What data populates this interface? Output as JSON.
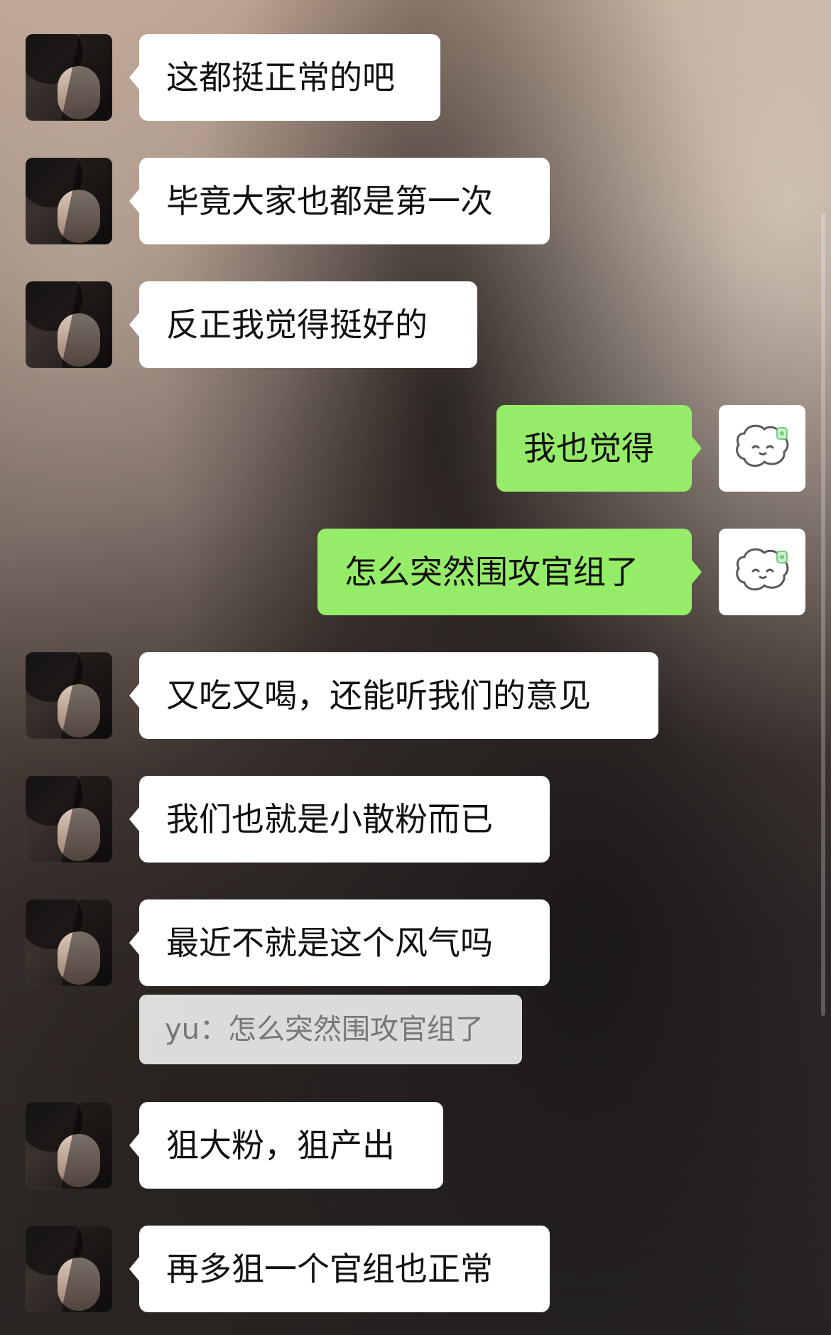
{
  "chat": {
    "messages": [
      {
        "side": "left",
        "text": "这都挺正常的吧"
      },
      {
        "side": "left",
        "text": "毕竟大家也都是第一次"
      },
      {
        "side": "left",
        "text": "反正我觉得挺好的"
      },
      {
        "side": "right",
        "text": "我也觉得"
      },
      {
        "side": "right",
        "text": "怎么突然围攻官组了"
      },
      {
        "side": "left",
        "text": "又吃又喝，还能听我们的意见"
      },
      {
        "side": "left",
        "text": "我们也就是小散粉而已"
      },
      {
        "side": "left",
        "text": "最近不就是这个风气吗"
      },
      {
        "side": "left",
        "text": "狙大粉，狙产出"
      },
      {
        "side": "left",
        "text": "再多狙一个官组也正常"
      }
    ],
    "quote": {
      "text": "yu：怎么突然围攻官组了"
    }
  }
}
